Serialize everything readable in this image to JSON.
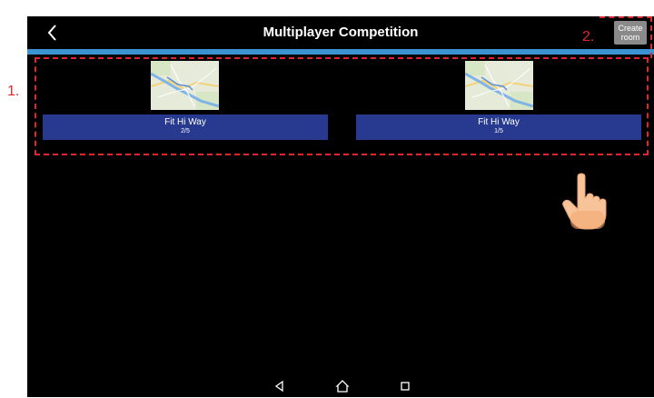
{
  "header": {
    "title": "Multiplayer Competition",
    "create_label": "Create room"
  },
  "rooms": [
    {
      "name": "Fit Hi Way",
      "players": "2/5"
    },
    {
      "name": "Fit Hi Way",
      "players": "1/5"
    }
  ],
  "annotations": {
    "label_1": "1.",
    "label_2": "2."
  },
  "colors": {
    "accent_bar": "#3b93d1",
    "room_button": "#283a8f",
    "annotation": "#e0262c",
    "create_button": "#8a8a8a"
  },
  "icons": {
    "back": "chevron-left-icon",
    "nav_back": "triangle-back-icon",
    "nav_home": "home-icon",
    "nav_recent": "square-recent-icon",
    "pointer": "hand-pointer-icon"
  }
}
